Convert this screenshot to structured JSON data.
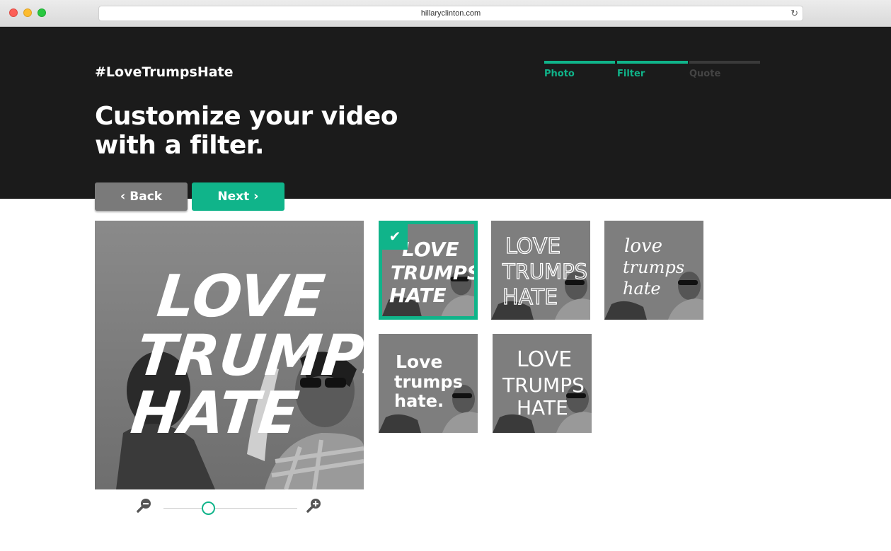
{
  "browser": {
    "url": "hillaryclinton.com"
  },
  "header": {
    "hashtag": "#LoveTrumpsHate",
    "headline_line1": "Customize your video",
    "headline_line2": "with a filter."
  },
  "steps": [
    {
      "label": "Photo",
      "active": true
    },
    {
      "label": "Filter",
      "active": true
    },
    {
      "label": "Quote",
      "active": false
    }
  ],
  "buttons": {
    "back": "Back",
    "next": "Next"
  },
  "preview": {
    "line1": "LOVE",
    "line2": "TRUMPS",
    "line3": "HATE"
  },
  "filters": [
    {
      "style": "brush caps",
      "lines": [
        "LOVE",
        "TRUMPS",
        "HATE"
      ],
      "selected": true
    },
    {
      "style": "outline caps",
      "lines": [
        "LOVE",
        "TRUMPS",
        "HATE"
      ],
      "selected": false
    },
    {
      "style": "script",
      "lines": [
        "love",
        "trumps",
        "hate"
      ],
      "selected": false
    },
    {
      "style": "bold sans",
      "lines": [
        "Love",
        "trumps",
        "hate."
      ],
      "selected": false
    },
    {
      "style": "thin caps",
      "lines": [
        "LOVE",
        "TRUMPS",
        "HATE"
      ],
      "selected": false
    }
  ],
  "zoom": {
    "level": 0.3
  },
  "colors": {
    "accent": "#10b48a",
    "header_bg": "#1b1b1b",
    "back_button": "#7a7a7a"
  }
}
